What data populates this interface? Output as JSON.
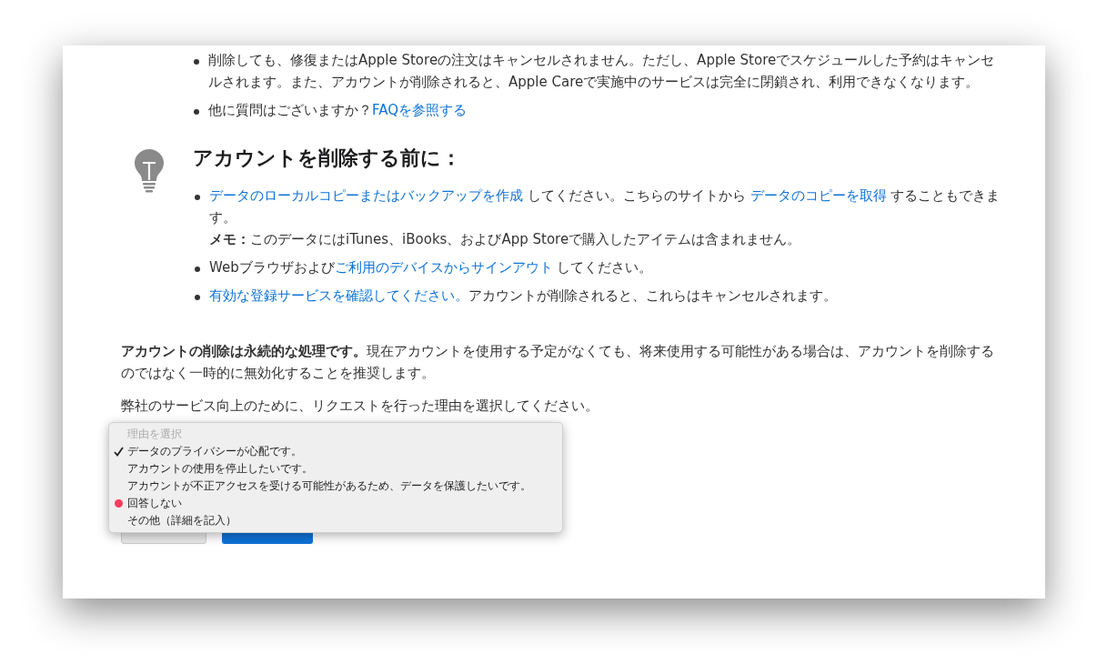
{
  "top_bullets": [
    {
      "segments": [
        {
          "kind": "text",
          "text": "削除しても、修復またはApple Storeの注文はキャンセルされません。ただし、Apple Storeでスケジュールした予約はキャンセルされます。また、アカウントが削除されると、Apple Careで実施中のサービスは完全に閉鎖され、利用できなくなります。"
        }
      ]
    },
    {
      "segments": [
        {
          "kind": "text",
          "text": "他に質問はございますか？"
        },
        {
          "kind": "link",
          "text": "FAQを参照する"
        }
      ]
    }
  ],
  "before_section": {
    "heading": "アカウントを削除する前に：",
    "bullets": [
      {
        "segments": [
          {
            "kind": "link",
            "text": "データのローカルコピーまたはバックアップを作成"
          },
          {
            "kind": "text",
            "text": " してください。こちらのサイトから "
          },
          {
            "kind": "link",
            "text": "データのコピーを取得"
          },
          {
            "kind": "text",
            "text": " することもできます。"
          }
        ],
        "note": "**メモ：**このデータにはiTunes、iBooks、およびApp Storeで購入したアイテムは含まれません。"
      },
      {
        "segments": [
          {
            "kind": "text",
            "text": "Webブラウザおよび"
          },
          {
            "kind": "link",
            "text": "ご利用のデバイスからサインアウト"
          },
          {
            "kind": "text",
            "text": " してください。"
          }
        ]
      },
      {
        "segments": [
          {
            "kind": "link",
            "text": "有効な登録サービスを確認してください。"
          },
          {
            "kind": "text",
            "text": "アカウントが削除されると、これらはキャンセルされます。"
          }
        ]
      }
    ]
  },
  "notice": "**アカウントの削除は永続的な処理です。**現在アカウントを使用する予定がなくても、将来使用する可能性がある場合は、アカウントを削除するのではなく一時的に無効化することを推奨します。",
  "prompt": "弊社のサービス向上のために、リクエストを行った理由を選択してください。",
  "reason_menu": {
    "items": [
      {
        "kind": "header",
        "text": "理由を選択",
        "selected": false
      },
      {
        "kind": "option",
        "text": "データのプライバシーが心配です。",
        "selected": true
      },
      {
        "kind": "option",
        "text": "アカウントの使用を停止したいです。",
        "selected": false
      },
      {
        "kind": "option",
        "text": "アカウントが不正アクセスを受ける可能性があるため、データを保護したいです。",
        "selected": false
      },
      {
        "kind": "option",
        "text": "回答しない",
        "selected": false,
        "color": "#ff3b5c"
      },
      {
        "kind": "option",
        "text": "その他（詳細を記入）",
        "selected": false
      }
    ]
  }
}
